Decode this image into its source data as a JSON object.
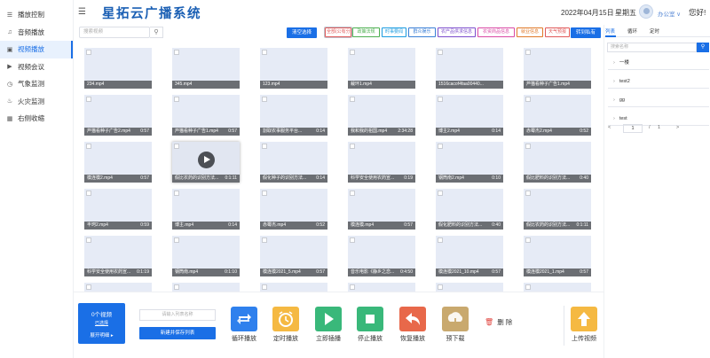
{
  "sidebar": {
    "items": [
      {
        "label": "播放控制",
        "icon": "list-icon"
      },
      {
        "label": "音频播放",
        "icon": "headphone-icon"
      },
      {
        "label": "视频播放",
        "icon": "video-icon"
      },
      {
        "label": "视频会议",
        "icon": "camera-icon"
      },
      {
        "label": "气象监测",
        "icon": "clock-icon"
      },
      {
        "label": "火灾监测",
        "icon": "fire-icon"
      },
      {
        "label": "右侧收缩",
        "icon": "grid-icon"
      }
    ],
    "active_index": 2
  },
  "header": {
    "title": "星拓云广播系统",
    "date": "2022年04月15日",
    "weekday": "星期五",
    "user": "办公室 ∨",
    "greeting": "您好!"
  },
  "toolbar": {
    "search_placeholder": "搜索视频",
    "clear_label": "清空选择",
    "move_label": "转到私有",
    "tags": [
      {
        "label": "全部(公有分类",
        "color": "#e05a5a"
      },
      {
        "label": "政策法规",
        "color": "#4caf50"
      },
      {
        "label": "时事要闻",
        "color": "#1a9be0"
      },
      {
        "label": "群众娱乐",
        "color": "#3a7fd6"
      },
      {
        "label": "农产品供求信息",
        "color": "#7c4dcc"
      },
      {
        "label": "农资商品信息",
        "color": "#d94aa5"
      },
      {
        "label": "就业信息",
        "color": "#e07a2a"
      },
      {
        "label": "天气预报",
        "color": "#e05a5a"
      }
    ]
  },
  "videos": [
    {
      "name": "234.mp4",
      "duration": ""
    },
    {
      "name": "345.mp4",
      "duration": ""
    },
    {
      "name": "123.mp4",
      "duration": ""
    },
    {
      "name": "裁环1.mp4",
      "duration": ""
    },
    {
      "name": "1516cacof4faa00440...",
      "duration": ""
    },
    {
      "name": "芦猫看种子广告1.mp4",
      "duration": ""
    },
    {
      "name": "芦猫看种子广告2.mp4",
      "duration": "0:57"
    },
    {
      "name": "芦猫看种子广告1.mp4",
      "duration": "0:57"
    },
    {
      "name": "割取农事服务平台...",
      "duration": "0:14"
    },
    {
      "name": "我和我的祖国.mp4",
      "duration": "2:34:28"
    },
    {
      "name": "博主2.mp4",
      "duration": "0:14"
    },
    {
      "name": "赤霉杰2.mp4",
      "duration": "0:52"
    },
    {
      "name": "模连模2.mp4",
      "duration": "0:57"
    },
    {
      "name": "假比农药的识别方法...",
      "duration": "0:1:11"
    },
    {
      "name": "假化种子的识别方法...",
      "duration": "0:14"
    },
    {
      "name": "科学安全使用农药宣...",
      "duration": "0:19"
    },
    {
      "name": "钢筒南2.mp4",
      "duration": "0:10"
    },
    {
      "name": "假比肥料的识别方法...",
      "duration": "0:40"
    },
    {
      "name": "丰珂2.mp4",
      "duration": "0:59"
    },
    {
      "name": "博主.mp4",
      "duration": "0:14"
    },
    {
      "name": "赤霉杰.mp4",
      "duration": "0:52"
    },
    {
      "name": "模连模.mp4",
      "duration": "0:57"
    },
    {
      "name": "假化肥料的识别方法...",
      "duration": "0:40"
    },
    {
      "name": "假比农药的识别方法...",
      "duration": "0:1:11"
    },
    {
      "name": "科学安全使用农药宣...",
      "duration": "0:1:19"
    },
    {
      "name": "钢筒南.mp4",
      "duration": "0:1:10"
    },
    {
      "name": "模连模2021_5.mp4",
      "duration": "0:57"
    },
    {
      "name": "音乐电影《静乡之恋...",
      "duration": "0:4:50"
    },
    {
      "name": "模连模2021_10.mp4",
      "duration": "0:57"
    },
    {
      "name": "模连模2021_1.mp4",
      "duration": "0:57"
    },
    {
      "name": "",
      "duration": ""
    },
    {
      "name": "",
      "duration": ""
    },
    {
      "name": "",
      "duration": ""
    },
    {
      "name": "",
      "duration": ""
    },
    {
      "name": "",
      "duration": ""
    },
    {
      "name": "",
      "duration": ""
    }
  ],
  "right_panel": {
    "tabs": [
      "列表",
      "循环",
      "定时"
    ],
    "search_placeholder": "搜索名称",
    "items": [
      "一楼",
      "test2",
      "gg",
      "test"
    ],
    "page_current": "1",
    "page_separator": "/",
    "page_total": "1"
  },
  "actions": {
    "count_label": "0个视频",
    "selected_label": "已选择",
    "expand_label": "展开明细 ▸",
    "name_placeholder": "请输入列表名称",
    "save_label": "新建并保存列表",
    "buttons": [
      {
        "label": "循环播放",
        "icon": "loop-icon",
        "color": "#2f80ed"
      },
      {
        "label": "定时播放",
        "icon": "alarm-icon",
        "color": "#f5b942"
      },
      {
        "label": "立即插播",
        "icon": "play-icon",
        "color": "#39b87a"
      },
      {
        "label": "停止播放",
        "icon": "stop-icon",
        "color": "#39b87a"
      },
      {
        "label": "恢复播放",
        "icon": "undo-icon",
        "color": "#e8684a"
      },
      {
        "label": "预下载",
        "icon": "download-icon",
        "color": "#c9a96e"
      }
    ],
    "delete_label": "删 除",
    "upload_label": "上传视频"
  }
}
